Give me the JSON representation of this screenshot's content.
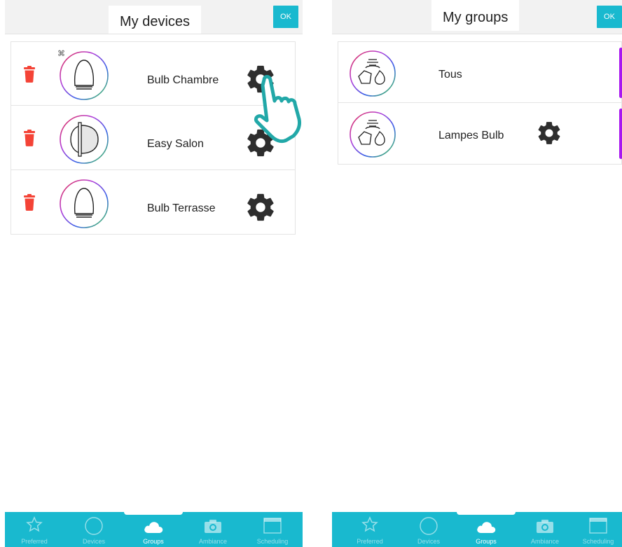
{
  "devices_panel": {
    "title": "My devices",
    "ok_label": "OK",
    "items": [
      {
        "name": "Bulb Chambre",
        "icon": "bulb-icon"
      },
      {
        "name": "Easy Salon",
        "icon": "spotlight-icon"
      },
      {
        "name": "Bulb Terrasse",
        "icon": "bulb-icon"
      }
    ]
  },
  "groups_panel": {
    "title": "My groups",
    "ok_label": "OK",
    "items": [
      {
        "name": "Tous",
        "icon": "group-lamps-icon"
      },
      {
        "name": "Lampes Bulb",
        "icon": "group-lamps-icon"
      }
    ]
  },
  "tabbar": {
    "tabs": [
      {
        "label": "Preferred",
        "icon": "star-icon"
      },
      {
        "label": "Devices",
        "icon": "circle-icon"
      },
      {
        "label": "Groups",
        "icon": "cloud-icon"
      },
      {
        "label": "Ambiance",
        "icon": "camera-icon"
      },
      {
        "label": "Scheduling",
        "icon": "calendar-icon"
      }
    ],
    "active_tab": "Groups"
  },
  "colors": {
    "accent": "#19b9cf",
    "delete": "#f44336",
    "group_bar": "#a817f0",
    "gear": "#2e2e2e"
  }
}
